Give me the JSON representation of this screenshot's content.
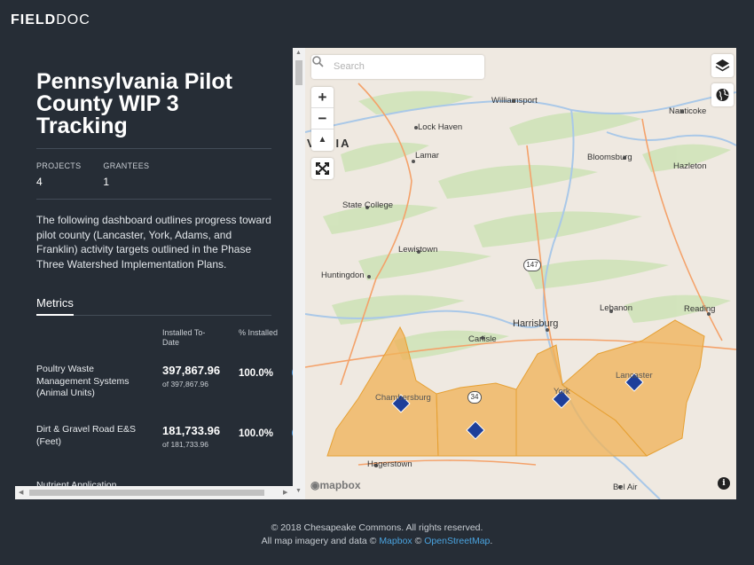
{
  "brand": {
    "bold": "FIELD",
    "thin": "DOC"
  },
  "dashboard": {
    "title": "Pennsylvania Pilot County WIP 3 Tracking",
    "stats": [
      {
        "label": "PROJECTS",
        "value": "4"
      },
      {
        "label": "GRANTEES",
        "value": "1"
      }
    ],
    "description": "The following dashboard outlines progress toward pilot county (Lancaster, York, Adams, and Franklin) activity targets outlined in the Phase Three Watershed Implementation Plans.",
    "metrics_tab": "Metrics",
    "col_installed": "Installed To-Date",
    "col_percent": "% Installed",
    "metrics": [
      {
        "name": "Poultry Waste Management Systems (Animal Units)",
        "value": "397,867.96",
        "target": "of 397,867.96",
        "percent": "100.0%"
      },
      {
        "name": "Dirt & Gravel Road E&S (Feet)",
        "value": "181,733.96",
        "target": "of 181,733.96",
        "percent": "100.0%"
      }
    ],
    "partial_metric": "Nutrient Application"
  },
  "map": {
    "search_placeholder": "Search",
    "zoom_in": "+",
    "zoom_out": "−",
    "compass": "▲",
    "state_label": "VANIA",
    "places": [
      "Williamsport",
      "Lock Haven",
      "Nanticoke",
      "Lamar",
      "Bloomsburg",
      "Hazleton",
      "State College",
      "Lewistown",
      "Huntingdon",
      "Harrisburg",
      "Lebanon",
      "Reading",
      "Carlisle",
      "Chambersburg",
      "York",
      "Lancaster",
      "Hagerstown",
      "Bel Air"
    ],
    "road_label": "147",
    "county_label": "34",
    "attribution_logo": "mapbox",
    "info": "i",
    "colors": {
      "county_fill": "#f0b45a",
      "marker": "#1e3f9a",
      "land": "#efe9e1"
    }
  },
  "footer": {
    "copyright": "© 2018 Chesapeake Commons. All rights reserved.",
    "imagery_prefix": "All map imagery and data ©",
    "mapbox_link": "Mapbox",
    "sep": "©",
    "osm_link": "OpenStreetMap",
    "suffix": "."
  }
}
